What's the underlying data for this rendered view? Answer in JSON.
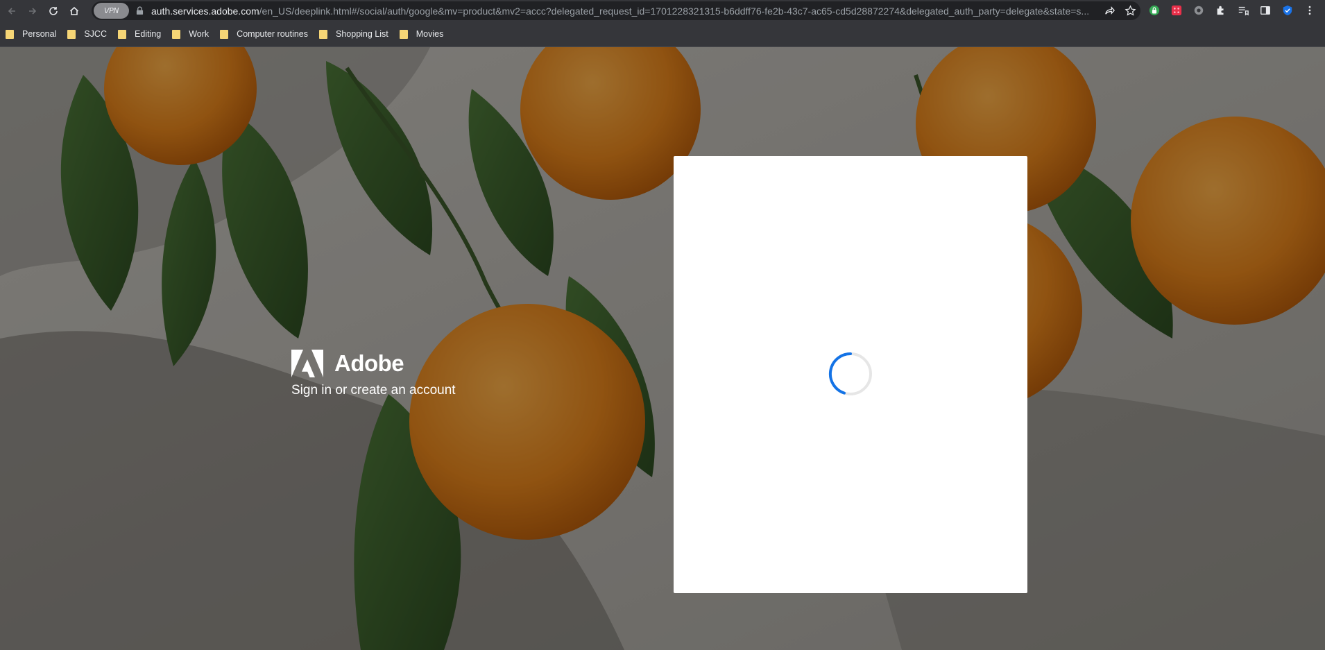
{
  "browser": {
    "vpn_chip": "VPN",
    "url_host": "auth.services.adobe.com",
    "url_path": "/en_US/deeplink.html#/social/auth/google&mv=product&mv2=accc?delegated_request_id=1701228321315-b6ddff76-fe2b-43c7-ac65-cd5d28872274&delegated_auth_party=delegate&state=s...",
    "nav_icons": [
      "back-icon",
      "forward-icon",
      "reload-icon",
      "home-icon"
    ],
    "extension_icons": [
      "share-icon",
      "star-icon",
      "extension-green-icon",
      "extension-red-icon",
      "extension-gear-icon",
      "puzzle-icon",
      "reading-list-icon",
      "side-panel-icon",
      "shield-check-icon",
      "kebab-menu-icon"
    ]
  },
  "bookmarks": [
    {
      "label": "Personal"
    },
    {
      "label": "SJCC"
    },
    {
      "label": "Editing"
    },
    {
      "label": "Work"
    },
    {
      "label": "Computer routines"
    },
    {
      "label": "Shopping List"
    },
    {
      "label": "Movies"
    }
  ],
  "page": {
    "brand_name": "Adobe",
    "tagline": "Sign in or create an account",
    "spinner_state": "loading",
    "accent_color": "#1473e6"
  }
}
